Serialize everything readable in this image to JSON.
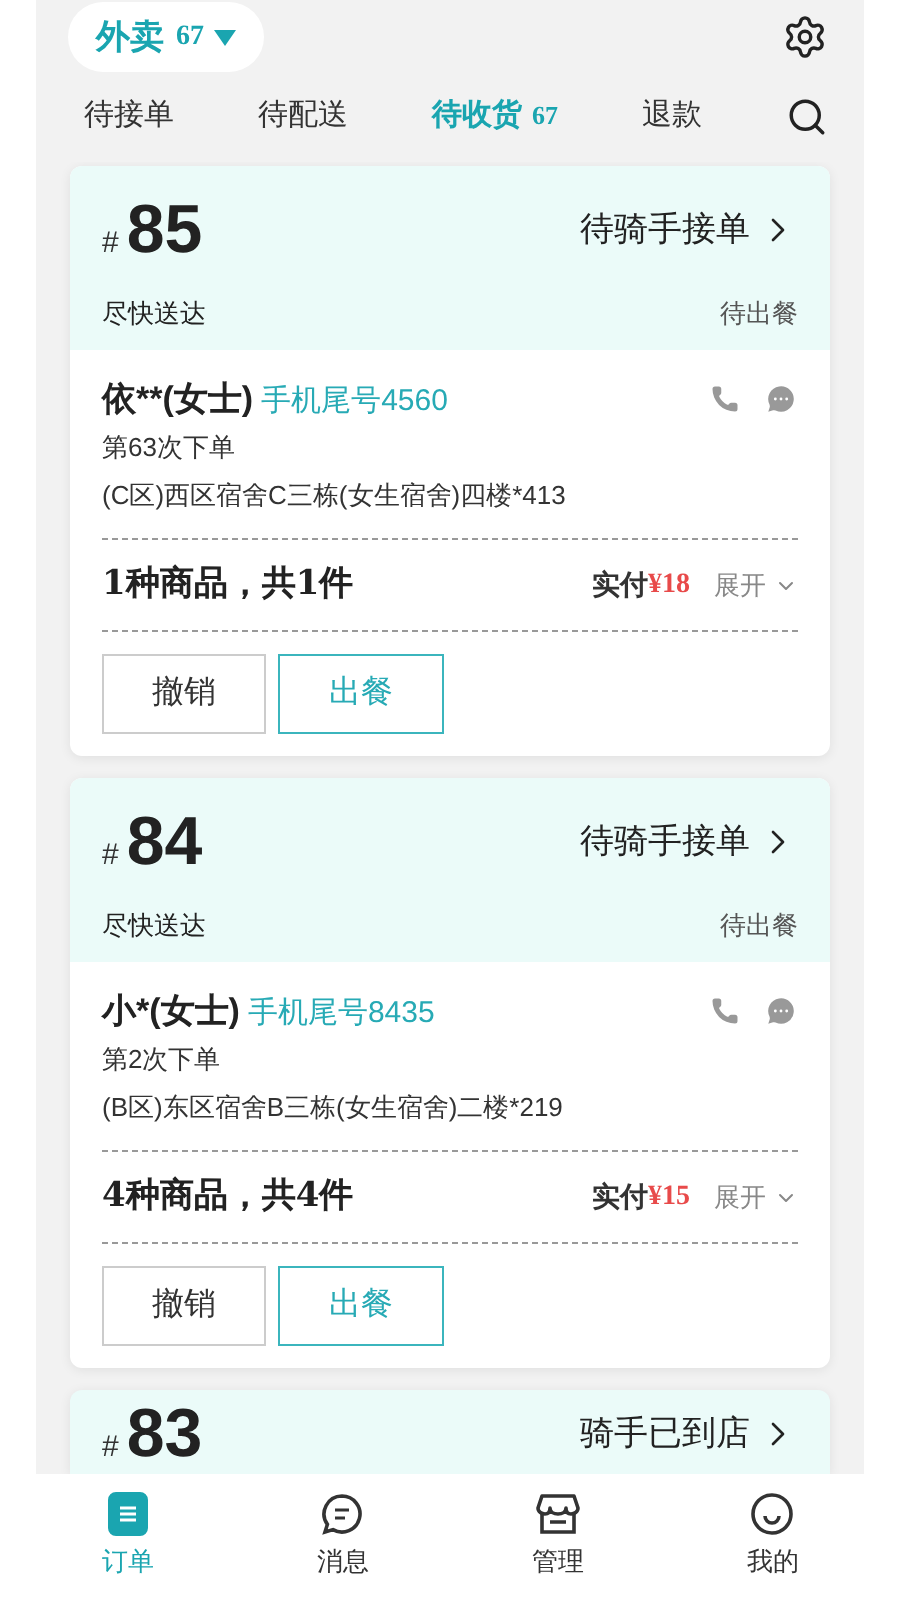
{
  "header": {
    "pill": {
      "label": "外卖",
      "count": "67"
    }
  },
  "tabs": [
    {
      "label": "待接单",
      "selected": false
    },
    {
      "label": "待配送",
      "selected": false
    },
    {
      "label": "待收货",
      "count": "67",
      "selected": true
    },
    {
      "label": "退款",
      "selected": false
    }
  ],
  "orders": [
    {
      "hash": "#",
      "number": "85",
      "status": "待骑手接单",
      "delivery": "尽快送达",
      "stage": "待出餐",
      "customer": "依**(女士)",
      "phone": "手机尾号4560",
      "order_count": "第63次下单",
      "address": "(C区)西区宿舍C三栋(女生宿舍)四楼*413",
      "summary": "1种商品，共1件",
      "paid_label": "实付",
      "paid": "¥18",
      "expand": "展开",
      "buttons": [
        "撤销",
        "出餐"
      ]
    },
    {
      "hash": "#",
      "number": "84",
      "status": "待骑手接单",
      "delivery": "尽快送达",
      "stage": "待出餐",
      "customer": "小*(女士)",
      "phone": "手机尾号8435",
      "order_count": "第2次下单",
      "address": "(B区)东区宿舍B三栋(女生宿舍)二楼*219",
      "summary": "4种商品，共4件",
      "paid_label": "实付",
      "paid": "¥15",
      "expand": "展开",
      "buttons": [
        "撤销",
        "出餐"
      ]
    },
    {
      "hash": "#",
      "number": "83",
      "status": "骑手已到店"
    }
  ],
  "bottom_nav": [
    {
      "kind": "orders",
      "label": "订单",
      "selected": true
    },
    {
      "kind": "messages",
      "label": "消息",
      "selected": false
    },
    {
      "kind": "manage",
      "label": "管理",
      "selected": false
    },
    {
      "kind": "me",
      "label": "我的",
      "selected": false
    }
  ]
}
